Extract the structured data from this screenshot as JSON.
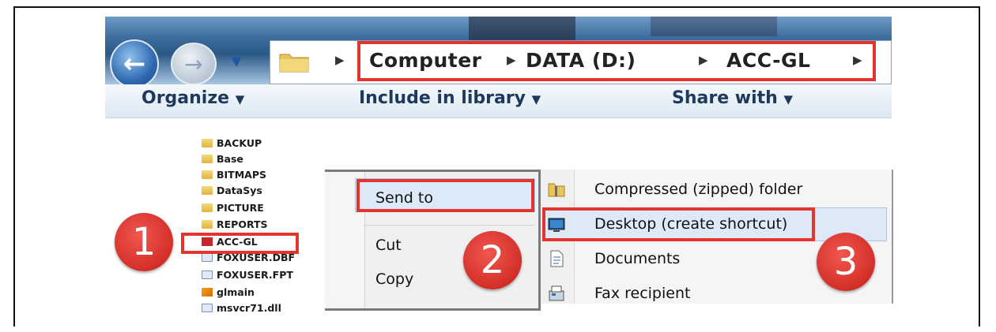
{
  "breadcrumb": {
    "items": [
      "Computer",
      "DATA (D:)",
      "ACC-GL"
    ]
  },
  "command_bar": {
    "organize": "Organize",
    "include_in_library": "Include in library",
    "share_with": "Share with"
  },
  "files": [
    {
      "name": "BACKUP",
      "icon": "folder-icon"
    },
    {
      "name": "Base",
      "icon": "folder-icon"
    },
    {
      "name": "BITMAPS",
      "icon": "folder-icon"
    },
    {
      "name": "DataSys",
      "icon": "folder-icon"
    },
    {
      "name": "PICTURE",
      "icon": "folder-icon"
    },
    {
      "name": "REPORTS",
      "icon": "folder-icon"
    },
    {
      "name": "ACC-GL",
      "icon": "app-icon"
    },
    {
      "name": "FOXUSER.DBF",
      "icon": "table-file-icon"
    },
    {
      "name": "FOXUSER.FPT",
      "icon": "table-file-icon"
    },
    {
      "name": "glmain",
      "icon": "fox-app-icon"
    },
    {
      "name": "msvcr71.dll",
      "icon": "dll-file-icon"
    }
  ],
  "context_menu": {
    "send_to": "Send to",
    "cut": "Cut",
    "copy": "Copy"
  },
  "send_to_menu": {
    "items": [
      {
        "label": "Compressed (zipped) folder",
        "icon": "zip-folder-icon"
      },
      {
        "label": "Desktop (create shortcut)",
        "icon": "desktop-icon"
      },
      {
        "label": "Documents",
        "icon": "documents-icon"
      },
      {
        "label": "Fax recipient",
        "icon": "fax-icon"
      }
    ]
  },
  "steps": [
    "1",
    "2",
    "3"
  ],
  "colors": {
    "highlight": "#e3342f",
    "badge": "#d5322b"
  }
}
